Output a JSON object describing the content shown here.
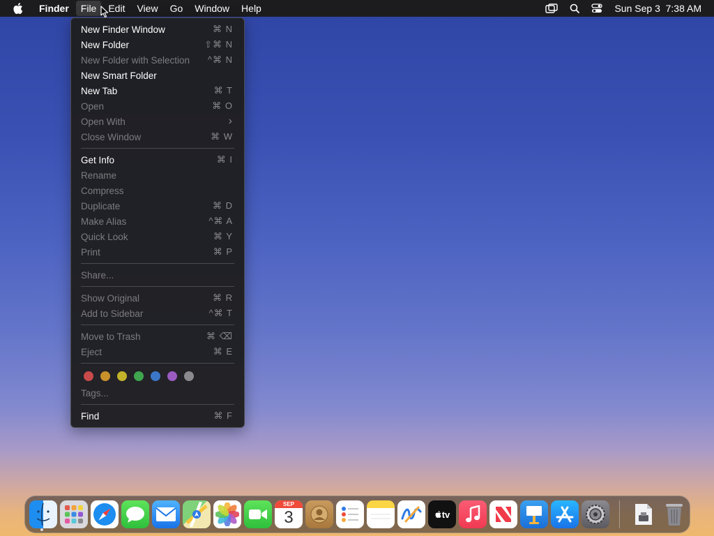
{
  "menubar": {
    "app_name": "Finder",
    "items": [
      "File",
      "Edit",
      "View",
      "Go",
      "Window",
      "Help"
    ],
    "clock": "Sun Sep 3  7:38 AM"
  },
  "file_menu": {
    "items": [
      {
        "label": "New Finder Window",
        "shortcut": "⌘ N",
        "enabled": true
      },
      {
        "label": "New Folder",
        "shortcut": "⇧⌘ N",
        "enabled": true
      },
      {
        "label": "New Folder with Selection",
        "shortcut": "^⌘ N",
        "enabled": false
      },
      {
        "label": "New Smart Folder",
        "shortcut": "",
        "enabled": true
      },
      {
        "label": "New Tab",
        "shortcut": "⌘ T",
        "enabled": true
      },
      {
        "label": "Open",
        "shortcut": "⌘ O",
        "enabled": false
      },
      {
        "label": "Open With",
        "shortcut": "›",
        "enabled": false
      },
      {
        "label": "Close Window",
        "shortcut": "⌘ W",
        "enabled": false
      },
      {
        "label": "Get Info",
        "shortcut": "⌘ I",
        "enabled": true
      },
      {
        "label": "Rename",
        "shortcut": "",
        "enabled": false
      },
      {
        "label": "Compress",
        "shortcut": "",
        "enabled": false
      },
      {
        "label": "Duplicate",
        "shortcut": "⌘ D",
        "enabled": false
      },
      {
        "label": "Make Alias",
        "shortcut": "^⌘ A",
        "enabled": false
      },
      {
        "label": "Quick Look",
        "shortcut": "⌘ Y",
        "enabled": false
      },
      {
        "label": "Print",
        "shortcut": "⌘ P",
        "enabled": false
      },
      {
        "label": "Share...",
        "shortcut": "",
        "enabled": false
      },
      {
        "label": "Show Original",
        "shortcut": "⌘ R",
        "enabled": false
      },
      {
        "label": "Add to Sidebar",
        "shortcut": "^⌘ T",
        "enabled": false
      },
      {
        "label": "Move to Trash",
        "shortcut": "⌘ ⌫",
        "enabled": false
      },
      {
        "label": "Eject",
        "shortcut": "⌘ E",
        "enabled": false
      },
      {
        "label": "Tags...",
        "shortcut": "",
        "enabled": false
      },
      {
        "label": "Find",
        "shortcut": "⌘ F",
        "enabled": true
      }
    ],
    "tag_colors": [
      "#c94a4a",
      "#c8912a",
      "#c2b22a",
      "#3fa64f",
      "#3b77c8",
      "#9a5cc0",
      "#8a8a8e"
    ]
  },
  "dock": {
    "apps": [
      "finder-icon",
      "launchpad-icon",
      "safari-icon",
      "messages-icon",
      "mail-icon",
      "maps-icon",
      "photos-icon",
      "facetime-icon",
      "calendar-icon",
      "contacts-icon",
      "reminders-icon",
      "notes-icon",
      "freeform-icon",
      "apple-tv-icon",
      "music-icon",
      "news-icon",
      "keynote-icon",
      "app-store-icon",
      "system-settings-icon",
      "downloads-icon",
      "trash-icon"
    ],
    "calendar_month": "SEP",
    "calendar_day": "3",
    "tv_label": "tv"
  }
}
